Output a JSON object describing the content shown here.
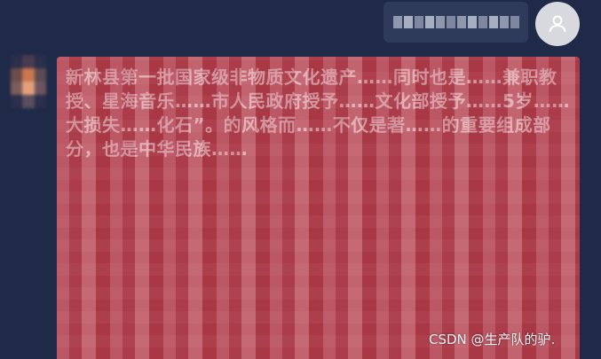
{
  "user_message": {
    "text_obscured": true
  },
  "bot_message": {
    "visible_text": "新林县第一批国家级非物质文化遗产……同时也是……兼职教授、星海音乐……市人民政府授予……文化部授予……5岁……大损失……化石”。的风格而……不仅是著……的重要组成部分，也是中华民族……"
  },
  "watermark": {
    "text": "CSDN @生产队的驴."
  },
  "colors": {
    "background": "#1f2a48",
    "bot_bubble": "#a8303b",
    "user_bubble": "#2f3b5a",
    "avatar": "#d7d9de"
  }
}
